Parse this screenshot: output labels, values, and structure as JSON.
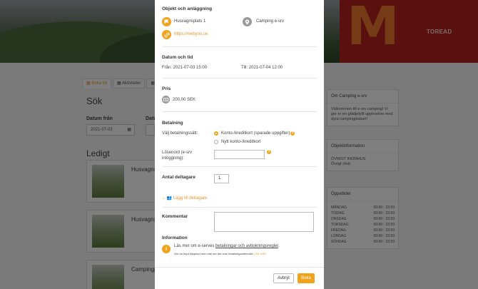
{
  "background": {
    "hero_brand": "M",
    "hero_brand_sub": "TOREAD",
    "tabs": [
      {
        "label": "Boka tid",
        "active": true
      },
      {
        "label": "Aktiviteter",
        "active": false
      },
      {
        "label": "",
        "active": false
      }
    ],
    "search_title": "Sök",
    "date_from_label": "Datum från",
    "date_from_value": "2021-07-03",
    "date_to_label": "Datu",
    "ledigt_title": "Ledigt",
    "cards": [
      {
        "name": "Husvagnsp"
      },
      {
        "name": "Husvagnsp"
      },
      {
        "name": "Campingpl"
      }
    ],
    "sidebar": {
      "about_title": "Om Camping e-srv",
      "about_text": "Välkommen till e-srv camping! Vi ger er en glädjefyllt upplevelse med dyra campingplatser!",
      "object_info_title": "Objektinformation",
      "object_info_type": "ÖVRIGT INOMHUS",
      "object_info_sub": "Övrigt (4st)",
      "hours_title": "Öppettider",
      "hours": [
        {
          "day": "MÅNDAG",
          "time": "00:00 - 23:59"
        },
        {
          "day": "TISDAG",
          "time": "00:00 - 23:59"
        },
        {
          "day": "ONSDAG",
          "time": "00:00 - 23:59"
        },
        {
          "day": "TORSDAG",
          "time": "00:00 - 23:59"
        },
        {
          "day": "FREDAG",
          "time": "00:00 - 23:59"
        },
        {
          "day": "LÖRDAG",
          "time": "00:00 - 23:59"
        },
        {
          "day": "SÖNDAG",
          "time": "00:00 - 23:59"
        }
      ]
    }
  },
  "modal": {
    "object_section": {
      "title": "Objekt och anläggning",
      "object_name": "Husvagnsplats 1",
      "facility_name": "Camping e-srv",
      "website": "https://mebyou.se"
    },
    "datetime_section": {
      "title": "Datum och tid",
      "from": "Från: 2021-07-03 15:00",
      "to": "Till: 2021-07-04 12:00"
    },
    "price_section": {
      "title": "Pris",
      "price": "200,00 SEK"
    },
    "payment_section": {
      "title": "Betalning",
      "method_label": "Välj betalningssätt:",
      "option_saved": "Konto-/kreditkort (sparade uppgifter)",
      "option_new": "Nytt konto-/kreditkort",
      "password_label": "Lösenord (e-srv inloggning):",
      "password_value": ""
    },
    "participants_section": {
      "title": "Antal deltagare",
      "count": "1",
      "add_label": "Lägg till deltagare"
    },
    "comment_section": {
      "title": "Kommentar",
      "value": ""
    },
    "info_section": {
      "title": "Information",
      "text_before": "Läs mer om e-serves ",
      "link_text": "betalningar och avbokningsregler",
      "text_after": ".",
      "small_text": "Om du köpt klippkort men inte ser det som betalningsalternativ",
      "small_link": "LÄS HÄR."
    },
    "buttons": {
      "cancel": "Avbryt",
      "book": "Boka"
    }
  },
  "colors": {
    "accent": "#f0a31c",
    "overlay": "rgba(0,0,0,0.5)"
  }
}
